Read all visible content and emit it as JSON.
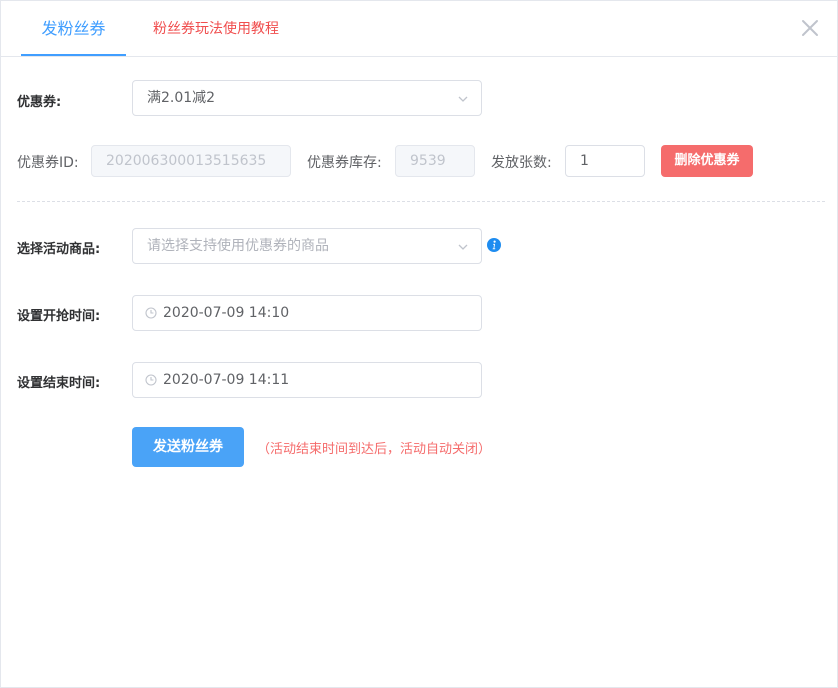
{
  "tabs": [
    {
      "label": "发粉丝券",
      "active": true
    },
    {
      "label": "粉丝券玩法使用教程",
      "active": false
    }
  ],
  "icons": {
    "close": "close-icon",
    "chevron": "chevron-down-icon",
    "clock": "clock-icon",
    "info": "info-icon"
  },
  "colors": {
    "accent": "#409eff",
    "danger": "#f56c6c",
    "tab_red": "#f04e4e"
  },
  "coupon": {
    "label": "优惠券:",
    "selected": "满2.01减2",
    "id_label": "优惠券ID:",
    "id_value": "202006300013515635",
    "stock_label": "优惠券库存:",
    "stock_value": "9539",
    "quantity_label": "发放张数:",
    "quantity_value": "1",
    "delete_label": "删除优惠券"
  },
  "product": {
    "label": "选择活动商品:",
    "placeholder": "请选择支持使用优惠券的商品"
  },
  "start_time": {
    "label": "设置开抢时间:",
    "value": "2020-07-09 14:10"
  },
  "end_time": {
    "label": "设置结束时间:",
    "value": "2020-07-09 14:11"
  },
  "send": {
    "label": "发送粉丝券",
    "note": "（活动结束时间到达后，活动自动关闭）"
  }
}
